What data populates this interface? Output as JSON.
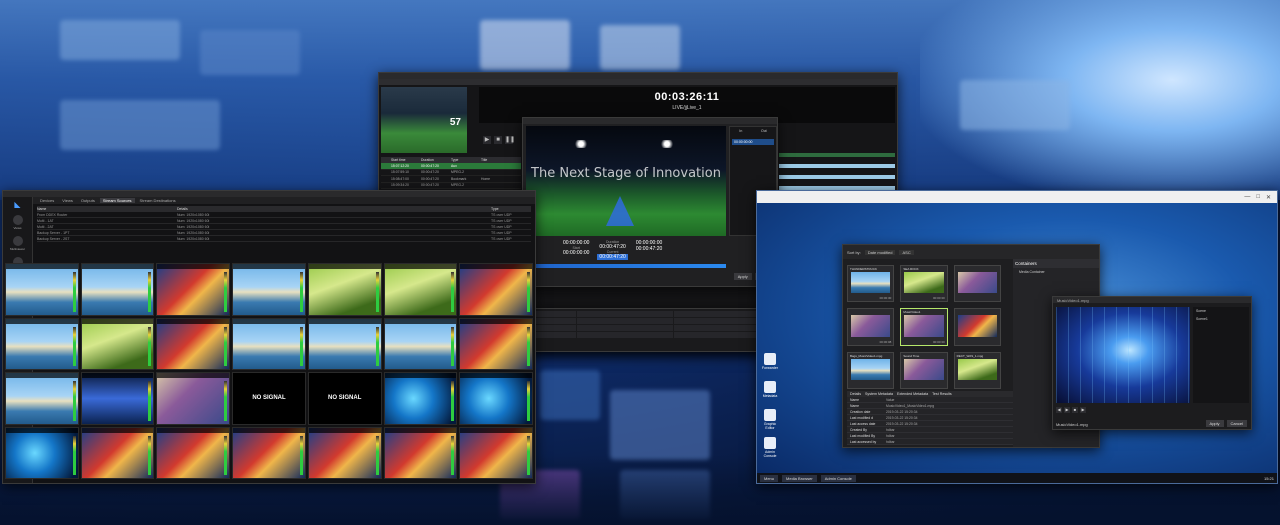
{
  "playout": {
    "time": "00:03:26:11",
    "channel": "LIVE/jjLive_1",
    "score": "57",
    "columns": [
      "",
      "Start time",
      "Duration",
      "Type",
      "Title"
    ],
    "rows": [
      [
        "",
        "15:07:12:20",
        "00:00:47:20",
        "Aux",
        ""
      ],
      [
        "",
        "15:07:59:10",
        "00:00:47:20",
        "MPEG-2",
        ""
      ],
      [
        "",
        "15:08:47:00",
        "00:00:47:20",
        "Bookmark",
        "Home"
      ],
      [
        "",
        "15:09:34:20",
        "00:00:47:20",
        "MPEG-2",
        ""
      ],
      [
        "",
        "15:10:22:10",
        "00:00:47:20",
        "MPEG-2",
        ""
      ],
      [
        "",
        "15:11:10:00",
        "00:00:47:20",
        "MPEG-2",
        ""
      ],
      [
        "",
        "15:11:57:20",
        "00:00:47:20",
        "Bookmark",
        "Home"
      ],
      [
        "",
        "15:12:45:10",
        "00:00:47:20",
        "MPEG-2",
        ""
      ],
      [
        "",
        "15:13:33:00",
        "00:00:47:20",
        "MPEG-2",
        ""
      ],
      [
        "",
        "15:14:20:20",
        "00:00:47:20",
        "MPEG-2",
        ""
      ],
      [
        "",
        "15:15:08:10",
        "00:00:47:20",
        "Bookmark",
        "Home"
      ],
      [
        "",
        "15:15:56:00",
        "00:00:47:20",
        "MPEG-2",
        ""
      ],
      [
        "",
        "15:16:43:20",
        "00:00:47:20",
        "MPEG-2",
        ""
      ],
      [
        "",
        "15:17:31:10",
        "00:00:47:20",
        "MPEG-2",
        ""
      ],
      [
        "",
        "15:18:19:00",
        "00:00:47:20",
        "MPEG-2",
        ""
      ]
    ]
  },
  "preview": {
    "title_overlay": "The Next Stage of Innovation",
    "in_label": "In",
    "out_label": "Out",
    "in_value": "00:00:00:00",
    "out_value": "00:00:00:00",
    "duration_label": "Duration",
    "duration_value": "00:00:47:20",
    "start_label": "Start",
    "start_value": "00:00:00:00",
    "current_label": "Current",
    "current_value": "00:00:47:20",
    "end_value": "00:00:47:20",
    "side_item": "00:00:00:00",
    "apply": "Apply",
    "close": "Close"
  },
  "multiviewer": {
    "tabs": [
      "Devices",
      "Views",
      "Outputs",
      "Stream Sources",
      "Stream Destinations"
    ],
    "active_tab": "Stream Sources",
    "table_cols": [
      "Name",
      "Details",
      "Type"
    ],
    "table_rows": [
      [
        "From DDEX Router",
        "Num: 1920x1080 60i",
        "TS over UDP"
      ],
      [
        "Multi - 1AT",
        "Num: 1920x1080 60i",
        "TS over UDP"
      ],
      [
        "Multi - 2AT",
        "Num: 1920x1080 60i",
        "TS over UDP"
      ],
      [
        "Backup Server - 1PT",
        "Num: 1920x1080 60i",
        "TS over UDP"
      ],
      [
        "Backup Server - 2ST",
        "Num: 1920x1080 60i",
        "TS over UDP"
      ]
    ],
    "no_signal": "NO SIGNAL",
    "side": [
      "Views",
      "Multiviewer",
      "Tasks",
      "Settings",
      "Admin"
    ]
  },
  "mediabrowser": {
    "sort_label": "Sort by:",
    "sort_value": "Date modified",
    "order": "ASC",
    "containers": "Containers",
    "container_item": "Media Container",
    "thumbs": [
      {
        "name": "THUNDERSTRUCK",
        "dur": "00:00:30"
      },
      {
        "name": "SEA ROCK",
        "dur": "00:00:30"
      },
      {
        "name": "",
        "dur": ""
      },
      {
        "name": "",
        "dur": "00:00:08"
      },
      {
        "name": "MusicVideo1",
        "dur": "00:00:30"
      },
      {
        "name": "",
        "dur": ""
      },
      {
        "name": "Bags_MusicVideo1.mpg",
        "dur": ""
      },
      {
        "name": "Sound Time",
        "dur": ""
      },
      {
        "name": "RECT_WAS_1.mpg",
        "dur": ""
      }
    ],
    "detail_tabs": [
      "Details",
      "System Metadata",
      "Extended Metadata",
      "Test Results"
    ],
    "details": [
      [
        "Name",
        "Value"
      ],
      [
        "Name",
        "MusicVideo1_MusicVideo1.mpg"
      ],
      [
        "Creation date",
        "2019-03-22 15:20:34"
      ],
      [
        "Last modified d",
        "2019-03-22 15:20:34"
      ],
      [
        "Last access date",
        "2019-03-22 15:20:34"
      ],
      [
        "Created By",
        "hdbar"
      ],
      [
        "Last modified By",
        "hdbar"
      ],
      [
        "Last accessed by",
        "hdbar"
      ]
    ],
    "video_title": "MusicVideo1.mpg",
    "video_side": [
      "Scene",
      "Scene1"
    ],
    "video_name": "MusicVideo1.mpg",
    "apply": "Apply",
    "cancel": "Cancel",
    "desktop": [
      "Forwarder",
      "Metadata",
      "Graphic Editor",
      "Admin Console"
    ],
    "taskbar": [
      "Menu",
      "Media Browser",
      "Admin Console"
    ],
    "clock": "15:21"
  }
}
